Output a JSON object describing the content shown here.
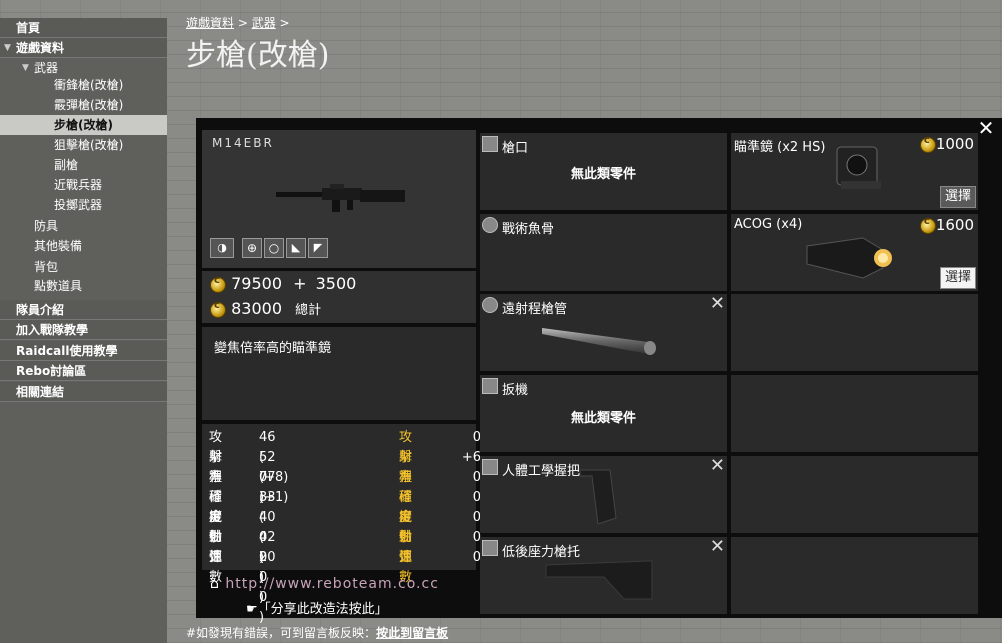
{
  "sidebar": {
    "top": [
      {
        "label": "首頁"
      },
      {
        "label": "遊戲資料"
      },
      {
        "label": "隊員介紹"
      },
      {
        "label": "加入戰隊教學"
      },
      {
        "label": "Raidcall使用教學"
      },
      {
        "label": "Rebo討論區"
      },
      {
        "label": "相關連結"
      }
    ],
    "weapons_label": "武器",
    "weapon_items": [
      {
        "label": "衝鋒槍(改槍)"
      },
      {
        "label": "霰彈槍(改槍)"
      },
      {
        "label": "步槍(改槍)"
      },
      {
        "label": "狙擊槍(改槍)"
      },
      {
        "label": "副槍"
      },
      {
        "label": "近戰兵器"
      },
      {
        "label": "投擲武器"
      }
    ],
    "other_items": [
      {
        "label": "防具"
      },
      {
        "label": "其他裝備"
      },
      {
        "label": "背包"
      },
      {
        "label": "點數道具"
      }
    ]
  },
  "breadcrumb": {
    "part1": "遊戲資料",
    "sep1": " > ",
    "part2": "武器",
    "sep2": " >"
  },
  "page_title": "步槍(改槍)",
  "weapon": {
    "name": "M14EBR",
    "base_price": "79500",
    "plus": "+",
    "extra_price": "3500",
    "total_price": "83000",
    "total_label": "總計",
    "description": "變焦倍率高的瞄準鏡"
  },
  "stats": [
    {
      "label": "攻擊力",
      "value": "46 ( 0 )",
      "mod_label": "攻擊力",
      "mod_value": "0"
    },
    {
      "label": "射程",
      "value": "52 (+8)",
      "mod_label": "射程",
      "mod_value": "+6"
    },
    {
      "label": "準確度",
      "value": "77 (+1)",
      "mod_label": "準確度",
      "mod_value": "0"
    },
    {
      "label": "穩定性",
      "value": "33 ( 0 )",
      "mod_label": "穩定性",
      "mod_value": "0"
    },
    {
      "label": "機動性",
      "value": "40 ( 0 )",
      "mod_label": "機動性",
      "mod_value": "0"
    },
    {
      "label": "射速",
      "value": "42 ( 0 )",
      "mod_label": "射速",
      "mod_value": "0"
    },
    {
      "label": "彈數",
      "value": "20 ( 0 )",
      "mod_label": "彈數",
      "mod_value": "0"
    }
  ],
  "footer": {
    "url": "http://www.reboteam.co.cc",
    "share": "「分享此改造法按此」"
  },
  "slots": [
    {
      "label": "槍口",
      "empty_text": "無此類零件"
    },
    {
      "label": "戰術魚骨"
    },
    {
      "label": "遠射程槍管"
    },
    {
      "label": "扳機",
      "empty_text": "無此類零件"
    },
    {
      "label": "人體工學握把"
    },
    {
      "label": "低後座力槍托"
    }
  ],
  "options": [
    {
      "label": "瞄準鏡 (x2 HS)",
      "price": "1000",
      "button": "選擇"
    },
    {
      "label": "ACOG (x4)",
      "price": "1600",
      "button": "選擇"
    }
  ],
  "remove_symbol": "✕",
  "close_symbol": "✕",
  "bottom_note": {
    "text": "#如發現有錯誤，可到留言板反映：",
    "link": "按此到留言板"
  }
}
